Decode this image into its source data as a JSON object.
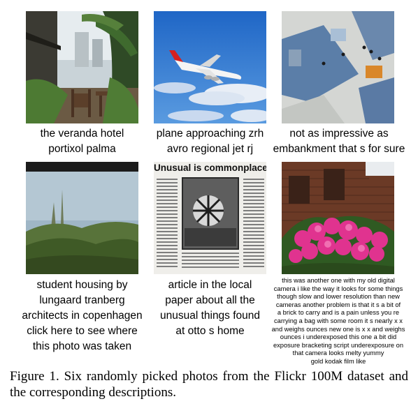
{
  "photos": [
    {
      "name": "veranda-hotel-photo",
      "caption": [
        "the veranda hotel",
        "portixol palma"
      ]
    },
    {
      "name": "plane-photo",
      "caption": [
        "plane approaching zrh",
        "avro regional jet rj"
      ]
    },
    {
      "name": "plaza-aerial-photo",
      "caption": [
        "not as impressive as",
        "embankment that s for sure"
      ]
    },
    {
      "name": "student-housing-photo",
      "caption": [
        "student housing by",
        "lungaard tranberg",
        "architects in copenhagen",
        "click here to see where",
        "this photo was taken"
      ]
    },
    {
      "name": "newspaper-article-photo",
      "caption": [
        "article in the local",
        "paper about all the",
        "unusual things found",
        "at otto s home"
      ],
      "headline": "Unusual is commonplace"
    },
    {
      "name": "pink-flowers-photo",
      "caption": [
        "this was another one with my old digital",
        "camera i like the way it looks for some things",
        "though slow and lower resolution than new",
        "cameras another problem is that it s a bit of",
        "a brick to carry and is a pain unless you re",
        "carrying a bag with some room it s nearly x x",
        "and weighs ounces new one is x x and weighs",
        "ounces i underexposed this one a bit did",
        "exposure bracketing script underexposure on",
        "that camera looks melty yummy",
        "gold kodak film like"
      ]
    }
  ],
  "figure_caption": {
    "label": "Figure 1.",
    "text": "Six randomly picked photos from the Flickr 100M dataset and the corresponding descriptions."
  },
  "colors": {
    "sky_blue": "#2f78cf",
    "foliage_green": "#4b6b2e",
    "flower_pink": "#e0338f",
    "brick_brown": "#6b3a26"
  }
}
